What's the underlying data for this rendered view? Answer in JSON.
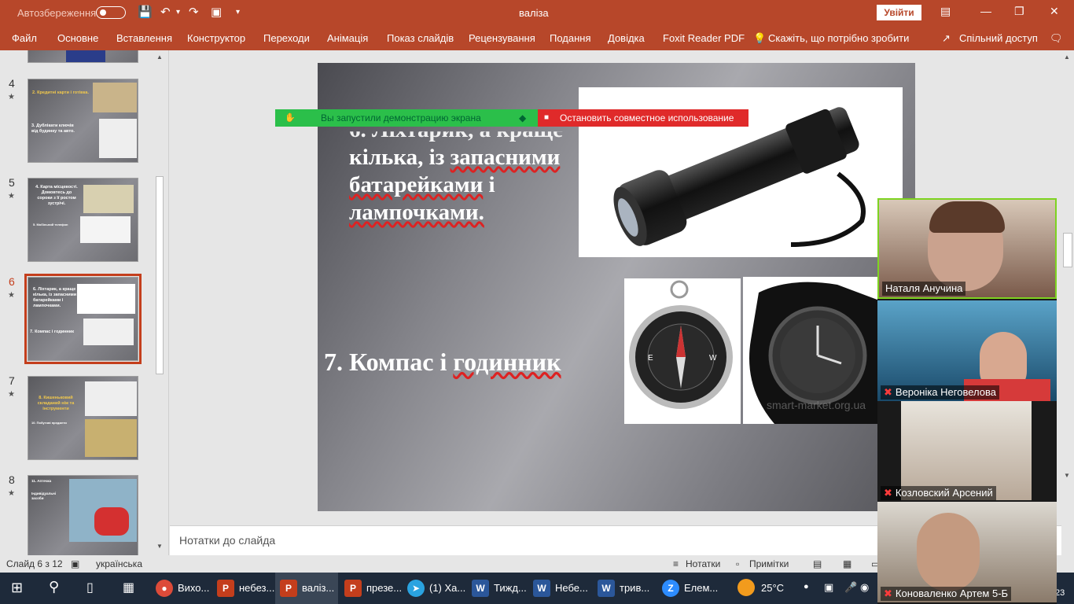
{
  "title_bar": {
    "autosave_label": "Автозбереження",
    "document_title": "валіза",
    "signin_label": "Увійти"
  },
  "ribbon": {
    "tabs": [
      "Файл",
      "Основне",
      "Вставлення",
      "Конструктор",
      "Переходи",
      "Анімація",
      "Показ слайдів",
      "Рецензування",
      "Подання",
      "Довідка",
      "Foxit Reader PDF"
    ],
    "tell_me": "Скажіть, що потрібно зробити",
    "share": "Спільний доступ"
  },
  "thumbnails": [
    {
      "number": "4",
      "title": "2. Кредитні карти і готівка.",
      "text": "3. Дублікати ключів від будинку та авто."
    },
    {
      "number": "5",
      "title": "4. Карта місцевості. Домовтесь до сороки з її ростом зустрічі.",
      "text": "5. Мобільний телефон"
    },
    {
      "number": "6",
      "title": "6. Ліхтарик, а краще кілька, із запасними батарейками і лампочками.",
      "text": "7. Компас і годинник"
    },
    {
      "number": "7",
      "title": "8. Кишеньковий складаний ніж та інструменти",
      "text": "10. Побутові предмети"
    },
    {
      "number": "8",
      "title": "11. Аптечка",
      "text": "Індивідуальні засоби"
    }
  ],
  "slide": {
    "text_top": [
      "кілька, із запасними",
      "батарейками і",
      "лампочками."
    ],
    "text_top_spell": "запасними",
    "text_bottom_prefix": "7. Компас і ",
    "text_bottom_spell": "годинник",
    "watermark": "smart-market.org.ua"
  },
  "share_bar": {
    "green_label": "Вы запустили демонстрацию экрана",
    "red_label": "Остановить совместное использование"
  },
  "notes": {
    "placeholder": "Нотатки до слайда"
  },
  "status_bar": {
    "slide_info": "Слайд 6 з 12",
    "language": "українська",
    "notes_btn": "Нотатки",
    "comments_btn": "Примітки"
  },
  "video_participants": [
    {
      "name": "Наталя Анучина",
      "muted": false
    },
    {
      "name": "Вероніка Неговелова",
      "muted": true
    },
    {
      "name": "Козловский Арсений",
      "muted": true
    },
    {
      "name": "Коноваленко Артем 5-Б",
      "muted": true
    }
  ],
  "taskbar": {
    "items": [
      {
        "label": "Вихо...",
        "icon_color": "#dd4b39"
      },
      {
        "label": "небез...",
        "icon_color": "#c43e1c"
      },
      {
        "label": "валіз...",
        "icon_color": "#c43e1c"
      },
      {
        "label": "презе...",
        "icon_color": "#c43e1c"
      },
      {
        "label": "(1) Ха...",
        "icon_color": "#2aa3e0"
      },
      {
        "label": "Тижд...",
        "icon_color": "#2b579a"
      },
      {
        "label": "Небе...",
        "icon_color": "#2b579a"
      },
      {
        "label": "трив...",
        "icon_color": "#2b579a"
      },
      {
        "label": "Елем...",
        "icon_color": "#2d8cff"
      }
    ],
    "weather": "25°C",
    "clock_fragment": "23"
  }
}
